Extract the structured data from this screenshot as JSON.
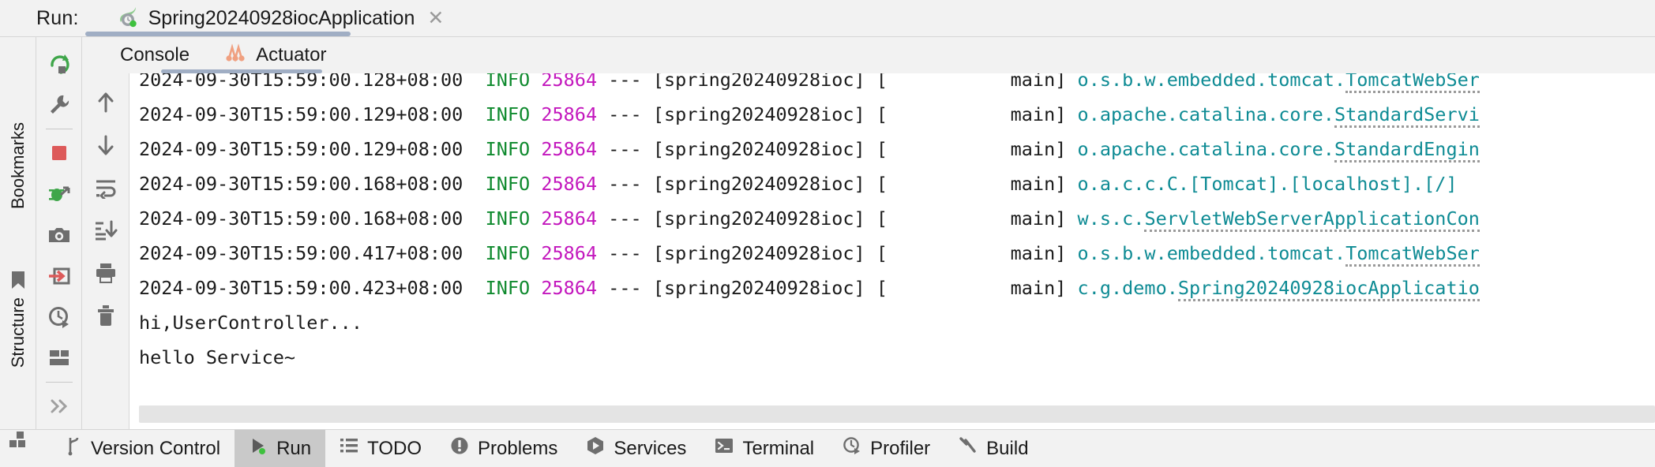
{
  "window": {
    "run_label": "Run:",
    "tab_title": "Spring20240928iocApplication",
    "tab_close": "✕",
    "tab_icon": "spring-boot-icon"
  },
  "run_toolbar": {
    "buttons": [
      {
        "name": "rerun-button",
        "icon": "rerun-icon",
        "tooltip": "Rerun"
      },
      {
        "name": "settings-button",
        "icon": "wrench-icon",
        "tooltip": "Modify Run Configuration"
      },
      {
        "name": "stop-button",
        "icon": "stop-square-icon",
        "tooltip": "Stop"
      },
      {
        "name": "attach-debugger-button",
        "icon": "attach-debugger-icon",
        "tooltip": "Attach Debugger"
      },
      {
        "name": "screenshot-button",
        "icon": "camera-icon",
        "tooltip": "Take Screenshot"
      },
      {
        "name": "dump-threads-button",
        "icon": "dump-threads-icon",
        "tooltip": "Dump Threads"
      },
      {
        "name": "profiler-button",
        "icon": "clock-run-icon",
        "tooltip": "Profiler"
      },
      {
        "name": "layout-button",
        "icon": "layout-icon",
        "tooltip": "Layout Settings"
      },
      {
        "name": "more-button",
        "icon": "chevron-double-right-icon",
        "tooltip": "More"
      }
    ]
  },
  "console_tabs": [
    {
      "label": "Console",
      "icon": "console-icon",
      "active": true
    },
    {
      "label": "Actuator",
      "icon": "actuator-icon",
      "active": false
    }
  ],
  "console_gutter": {
    "buttons": [
      {
        "name": "scroll-up-button",
        "icon": "arrow-up-icon",
        "tooltip": "Up the Stack Trace"
      },
      {
        "name": "scroll-down-button",
        "icon": "arrow-down-icon",
        "tooltip": "Down the Stack Trace"
      },
      {
        "name": "soft-wrap-button",
        "icon": "soft-wrap-icon",
        "tooltip": "Use Soft Wraps"
      },
      {
        "name": "scroll-to-end-button",
        "icon": "scroll-to-end-icon",
        "tooltip": "Scroll to the End"
      },
      {
        "name": "print-button",
        "icon": "printer-icon",
        "tooltip": "Print"
      },
      {
        "name": "clear-all-button",
        "icon": "trash-icon",
        "tooltip": "Clear All"
      }
    ]
  },
  "console": {
    "lines": [
      {
        "clipped": true,
        "time": "2024-09-30T15:59:00.128+08:00",
        "level": "INFO",
        "pid": "25864",
        "dash": "---",
        "app": "[spring20240928ioc]",
        "thread": "[           main]",
        "logger_prefix": "o.s.b.w.embedded.tomcat.",
        "logger_link": "TomcatWebSer"
      },
      {
        "clipped": false,
        "time": "2024-09-30T15:59:00.129+08:00",
        "level": "INFO",
        "pid": "25864",
        "dash": "---",
        "app": "[spring20240928ioc]",
        "thread": "[           main]",
        "logger_prefix": "o.apache.catalina.core.",
        "logger_link": "StandardServi"
      },
      {
        "clipped": false,
        "time": "2024-09-30T15:59:00.129+08:00",
        "level": "INFO",
        "pid": "25864",
        "dash": "---",
        "app": "[spring20240928ioc]",
        "thread": "[           main]",
        "logger_prefix": "o.apache.catalina.core.",
        "logger_link": "StandardEngin"
      },
      {
        "clipped": false,
        "time": "2024-09-30T15:59:00.168+08:00",
        "level": "INFO",
        "pid": "25864",
        "dash": "---",
        "app": "[spring20240928ioc]",
        "thread": "[           main]",
        "logger_prefix": "o.a.c.c.C.[Tomcat].[localhost].[/]",
        "logger_link": ""
      },
      {
        "clipped": false,
        "time": "2024-09-30T15:59:00.168+08:00",
        "level": "INFO",
        "pid": "25864",
        "dash": "---",
        "app": "[spring20240928ioc]",
        "thread": "[           main]",
        "logger_prefix": "w.s.c.",
        "logger_link": "ServletWebServerApplicationCon"
      },
      {
        "clipped": false,
        "time": "2024-09-30T15:59:00.417+08:00",
        "level": "INFO",
        "pid": "25864",
        "dash": "---",
        "app": "[spring20240928ioc]",
        "thread": "[           main]",
        "logger_prefix": "o.s.b.w.embedded.tomcat.",
        "logger_link": "TomcatWebSer"
      },
      {
        "clipped": false,
        "time": "2024-09-30T15:59:00.423+08:00",
        "level": "INFO",
        "pid": "25864",
        "dash": "---",
        "app": "[spring20240928ioc]",
        "thread": "[           main]",
        "logger_prefix": "c.g.demo.",
        "logger_link": "Spring20240928iocApplicatio"
      }
    ],
    "plain_lines": [
      "hi,UserController...",
      "hello Service~"
    ]
  },
  "left_strip": {
    "bookmarks_label": "Bookmarks",
    "structure_label": "Structure",
    "bookmark_icon": "bookmark-icon",
    "structure_icon": "structure-icon"
  },
  "status_bar": {
    "items": [
      {
        "label": "Version Control",
        "icon": "branch-icon",
        "active": false
      },
      {
        "label": "Run",
        "icon": "run-play-icon",
        "active": true
      },
      {
        "label": "TODO",
        "icon": "todo-list-icon",
        "active": false
      },
      {
        "label": "Problems",
        "icon": "problems-icon",
        "active": false
      },
      {
        "label": "Services",
        "icon": "services-icon",
        "active": false
      },
      {
        "label": "Terminal",
        "icon": "terminal-icon",
        "active": false
      },
      {
        "label": "Profiler",
        "icon": "profiler-icon",
        "active": false
      },
      {
        "label": "Build",
        "icon": "build-hammer-icon",
        "active": false
      }
    ]
  },
  "colors": {
    "accent_underline": "#a0aec4",
    "log_level": "#0f8a2e",
    "log_pid": "#c317bd",
    "log_class": "#0e8b94",
    "active_tab_bg": "#c9c9c9",
    "toolbar_bg": "#f2f2f2",
    "console_bg": "#ffffff"
  }
}
